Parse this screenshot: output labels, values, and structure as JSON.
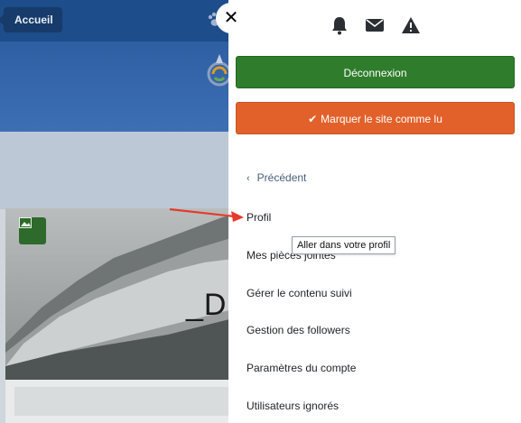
{
  "background": {
    "home_label": "Accueil",
    "photo_title": "_D"
  },
  "panel": {
    "close_glyph": "✕",
    "icons": [
      "bell-icon",
      "envelope-icon",
      "warning-icon"
    ],
    "logout_label": "Déconnexion",
    "mark_read_label": "Marquer le site comme lu",
    "colors": {
      "logout": "#2f7d2c",
      "mark_read": "#e2612a",
      "annotation_arrow": "#e53b2c"
    },
    "menu": {
      "previous_label": "Précédent",
      "items": [
        "Profil",
        "Mes pièces jointes",
        "Gérer le contenu suivi",
        "Gestion des followers",
        "Paramètres du compte",
        "Utilisateurs ignorés"
      ]
    },
    "tooltip": "Aller dans votre profil"
  }
}
